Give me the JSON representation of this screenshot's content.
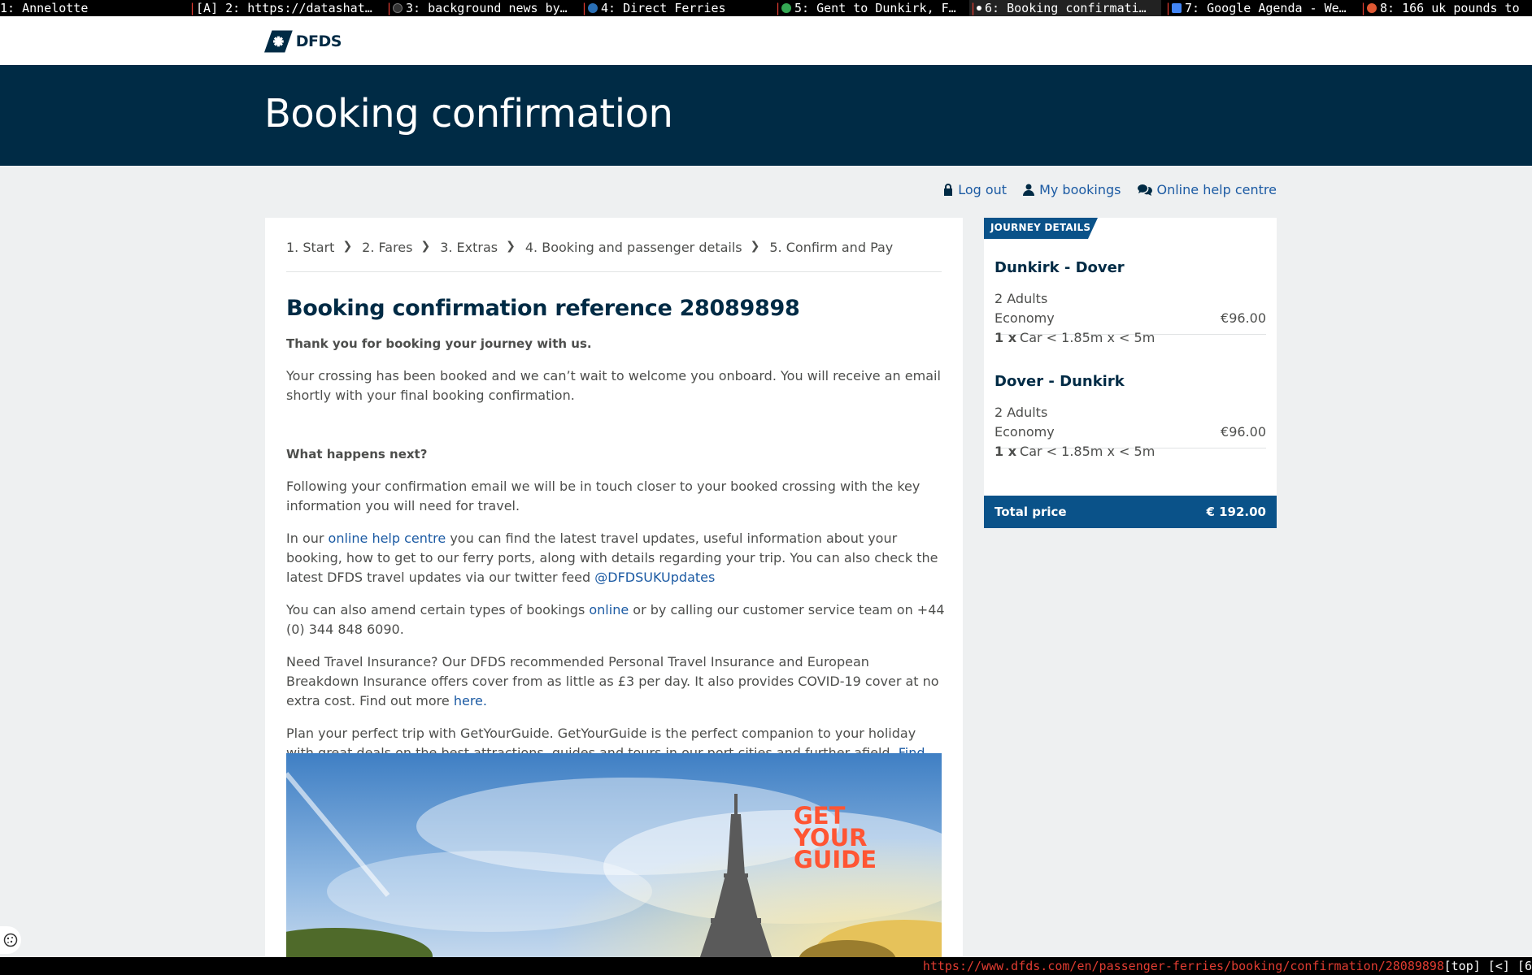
{
  "tabs": [
    {
      "label": "1: Annelotte",
      "active": false
    },
    {
      "label": "[A] 2: https://datashat…",
      "active": false
    },
    {
      "label": "3: background news by…",
      "active": false,
      "icon": "github-icon"
    },
    {
      "label": "4: Direct Ferries",
      "active": false,
      "icon": "ferry-icon"
    },
    {
      "label": "5: Gent to Dunkirk, F…",
      "active": false,
      "icon": "maps-icon"
    },
    {
      "label": "6: Booking confirmati…",
      "active": true,
      "icon": "dfds-icon"
    },
    {
      "label": "7: Google Agenda - We…",
      "active": false,
      "icon": "calendar-icon"
    },
    {
      "label": "8: 166 uk pounds to",
      "active": false,
      "icon": "duckduckgo-icon"
    }
  ],
  "brand": {
    "name": "DFDS",
    "color": "#002b45",
    "accent": "#0a5289"
  },
  "hero": {
    "title": "Booking confirmation"
  },
  "account_links": {
    "logout": "Log out",
    "my_bookings": "My bookings",
    "help": "Online help centre"
  },
  "steps": [
    {
      "label": "1. Start"
    },
    {
      "label": "2. Fares"
    },
    {
      "label": "3. Extras"
    },
    {
      "label": "4. Booking and passenger details"
    },
    {
      "label": "5. Confirm and Pay"
    }
  ],
  "content": {
    "heading": "Booking confirmation reference 28089898",
    "thanks": "Thank you for booking your journey with us.",
    "booked": "Your crossing has been booked and we can’t wait to welcome you onboard. You will receive an email shortly with your final booking confirmation.",
    "next_heading": "What happens next?",
    "following": "Following your confirmation email we will be in touch closer to your booked crossing with the key information you will need for travel.",
    "help_p1": "In our ",
    "help_link": "online help centre",
    "help_p2": " you can find the latest travel updates, useful information about your booking, how to get to our ferry ports, along with details regarding your trip. You can also check the latest DFDS travel updates via our twitter feed ",
    "twitter_link": "@DFDSUKUpdates",
    "amend_p1": "You can also amend certain types of bookings ",
    "amend_link": "online",
    "amend_p2": " or by calling our customer service team on +44 (0) 344 848 6090.",
    "insurance_p1": "Need Travel Insurance? Our DFDS recommended Personal Travel Insurance and European Breakdown Insurance offers cover from as little as £3 per day. It also provides COVID-19 cover at no extra cost. Find out more ",
    "insurance_link": "here.",
    "gyg_p1": "Plan your perfect trip with GetYourGuide. GetYourGuide is the perfect companion to your holiday with great deals on the best attractions, guides and tours in our port cities and further afield. ",
    "gyg_link": "Find out more here."
  },
  "promo": {
    "logo_lines": [
      "GET",
      "YOUR",
      "GUIDE"
    ],
    "logo_color": "#ff5533"
  },
  "journey": {
    "tag": "JOURNEY DETAILS",
    "legs": [
      {
        "route": "Dunkirk - Dover",
        "passengers": "2 Adults",
        "fare": "Economy",
        "price": "€96.00",
        "qty": "1 x",
        "vehicle": "Car < 1.85m x < 5m"
      },
      {
        "route": "Dover - Dunkirk",
        "passengers": "2 Adults",
        "fare": "Economy",
        "price": "€96.00",
        "qty": "1 x",
        "vehicle": "Car < 1.85m x < 5m"
      }
    ],
    "total_label": "Total price",
    "total_value": "€ 192.00"
  },
  "statusbar": {
    "url": "https://www.dfds.com/en/passenger-ferries/booking/confirmation/28089898",
    "tail": "[top] [<] [6"
  }
}
